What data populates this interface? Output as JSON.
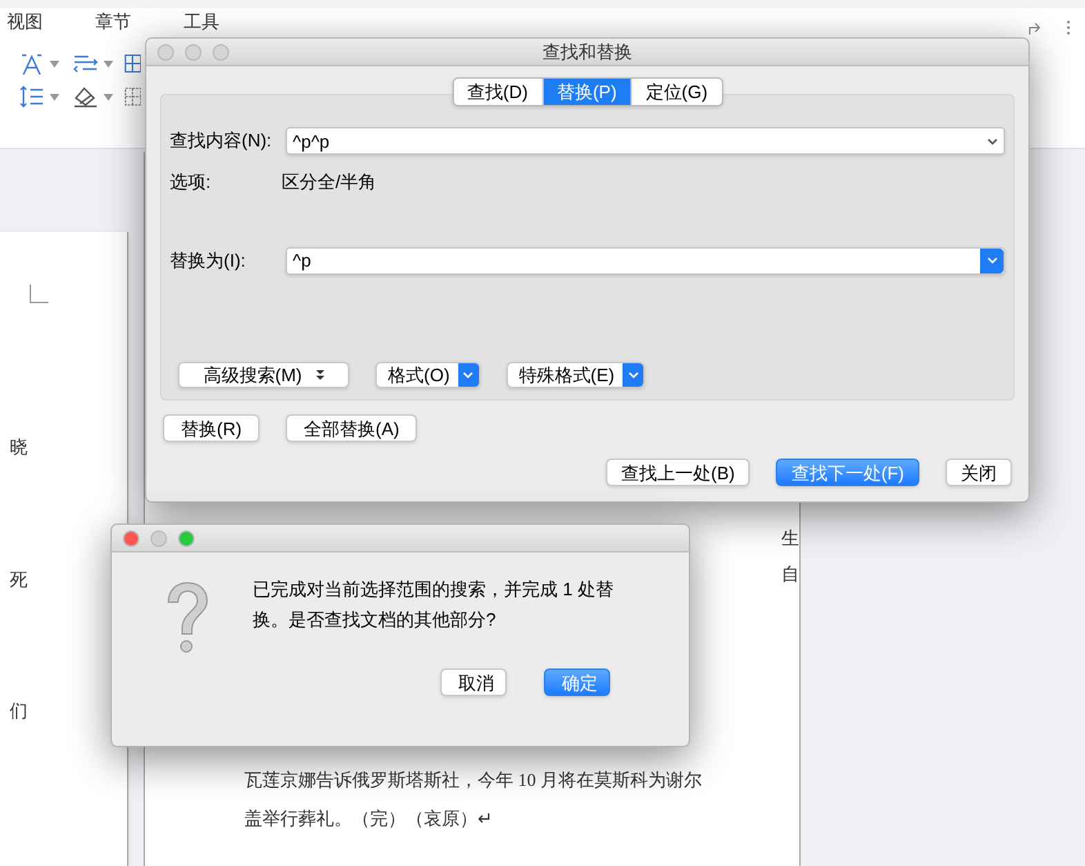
{
  "menu_tabs": [
    "视图",
    "章节",
    "工具"
  ],
  "document": {
    "page_1_fragments": [
      "晓",
      "死",
      "们"
    ],
    "page_2_fragments": [
      "生",
      "自"
    ],
    "page_2_lines": [
      "瓦莲京娜告诉俄罗斯塔斯社，今年 10 月将在莫斯科为谢尔",
      "盖举行葬礼。（完）（哀原）↵"
    ]
  },
  "find_replace": {
    "title": "查找和替换",
    "tabs": [
      {
        "label": "查找(D)",
        "selected": false
      },
      {
        "label": "替换(P)",
        "selected": true
      },
      {
        "label": "定位(G)",
        "selected": false
      }
    ],
    "fields": [
      {
        "label": "查找内容(N):",
        "value": "^p^p",
        "active": false
      },
      {
        "label": "替换为(I):",
        "value": "^p",
        "active": true
      }
    ],
    "options_label": "选项:",
    "options_value": "区分全/半角",
    "format_buttons": [
      {
        "label": "高级搜索(M)",
        "kind": "disclosure"
      },
      {
        "label": "格式(O)",
        "kind": "menu"
      },
      {
        "label": "特殊格式(E)",
        "kind": "menu"
      }
    ],
    "action_buttons": [
      "替换(R)",
      "全部替换(A)"
    ],
    "nav_buttons": [
      {
        "label": "查找上一处(B)",
        "default": false
      },
      {
        "label": "查找下一处(F)",
        "default": true
      },
      {
        "label": "关闭",
        "default": false
      }
    ]
  },
  "alert": {
    "message": "已完成对当前选择范围的搜索，并完成 1 处替换。是否查找文档的其他部分?",
    "buttons": [
      {
        "label": "取消",
        "default": false
      },
      {
        "label": "确定",
        "default": true
      }
    ]
  }
}
